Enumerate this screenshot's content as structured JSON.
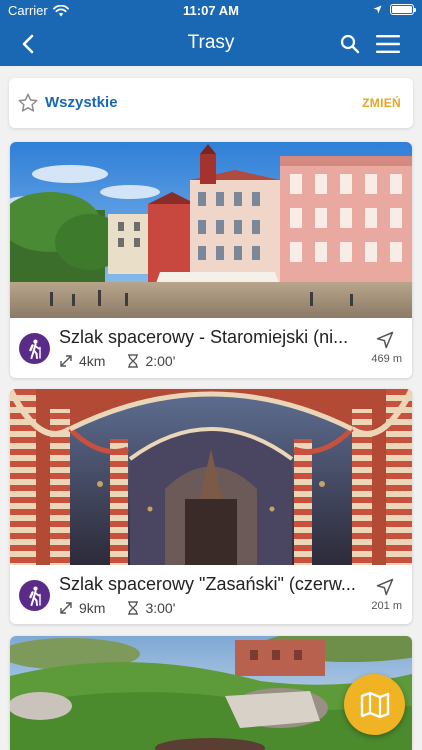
{
  "status_bar": {
    "carrier": "Carrier",
    "time": "11:07 AM",
    "battery_level": 1.0
  },
  "header": {
    "title": "Trasy",
    "back_icon": "chevron-left-icon",
    "search_icon": "search-icon",
    "menu_icon": "hamburger-menu-icon"
  },
  "filter": {
    "star_icon": "star-outline-icon",
    "label": "Wszystkie",
    "action": "ZMIEŃ"
  },
  "routes": [
    {
      "title": "Szlak spacerowy - Staromiejski (ni...",
      "distance": "4km",
      "duration": "2:00'",
      "proximity": "469 m",
      "activity_icon": "hiking-person-icon"
    },
    {
      "title": "Szlak spacerowy \"Zasański\" (czerw...",
      "distance": "9km",
      "duration": "3:00'",
      "proximity": "201 m",
      "activity_icon": "hiking-person-icon"
    },
    {
      "title": "",
      "distance": "",
      "duration": "",
      "proximity": ""
    }
  ],
  "map_button": {
    "icon": "map-icon"
  },
  "colors": {
    "primary": "#1a68b3",
    "accent": "#f0b323",
    "change_link": "#e3a624",
    "activity_badge": "#5b2b8a",
    "background": "#f1f1f1"
  }
}
